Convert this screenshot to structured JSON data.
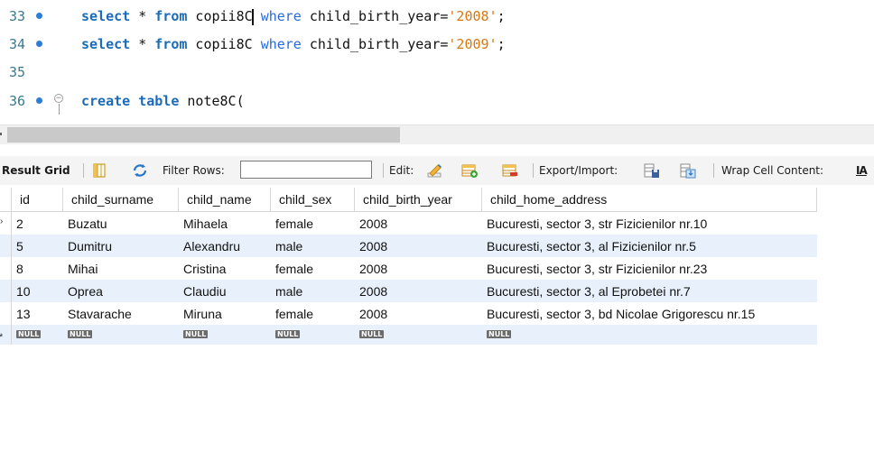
{
  "editor": {
    "lines": [
      {
        "num": "33",
        "parts": [
          [
            "kw",
            "select"
          ],
          [
            "",
            " * "
          ],
          [
            "kw",
            "from"
          ],
          [
            "",
            " copii8C"
          ],
          [
            "caret",
            ""
          ],
          [
            "",
            " "
          ],
          [
            "kw2",
            "where"
          ],
          [
            "",
            " child_birth_year="
          ],
          [
            "str",
            "'2008'"
          ],
          [
            "",
            ";"
          ]
        ]
      },
      {
        "num": "34",
        "parts": [
          [
            "kw",
            "select"
          ],
          [
            "",
            " * "
          ],
          [
            "kw",
            "from"
          ],
          [
            "",
            " copii8C "
          ],
          [
            "kw2",
            "where"
          ],
          [
            "",
            " child_birth_year="
          ],
          [
            "str",
            "'2009'"
          ],
          [
            "",
            ";"
          ]
        ]
      },
      {
        "num": "35",
        "parts": []
      },
      {
        "num": "36",
        "parts": [
          [
            "kw",
            "create"
          ],
          [
            "",
            " "
          ],
          [
            "kw",
            "table"
          ],
          [
            "",
            " note8C("
          ]
        ]
      }
    ]
  },
  "toolbar": {
    "result_grid_label": "Result Grid",
    "filter_rows_label": "Filter Rows:",
    "filter_value": "",
    "edit_label": "Edit:",
    "export_import_label": "Export/Import:",
    "wrap_cell_label": "Wrap Cell Content:",
    "wrap_icon_text": "IA"
  },
  "grid": {
    "columns": [
      "id",
      "child_surname",
      "child_name",
      "child_sex",
      "child_birth_year",
      "child_home_address"
    ],
    "rows": [
      [
        "2",
        "Buzatu",
        "Mihaela",
        "female",
        "2008",
        "Bucuresti, sector 3, str Fizicienilor nr.10"
      ],
      [
        "5",
        "Dumitru",
        "Alexandru",
        "male",
        "2008",
        "Bucuresti, sector 3, al Fizicienilor nr.5"
      ],
      [
        "8",
        "Mihai",
        "Cristina",
        "female",
        "2008",
        "Bucuresti, sector 3, str Fizicienilor nr.23"
      ],
      [
        "10",
        "Oprea",
        "Claudiu",
        "male",
        "2008",
        "Bucuresti, sector 3, al Eprobetei nr.7"
      ],
      [
        "13",
        "Stavarache",
        "Miruna",
        "female",
        "2008",
        "Bucuresti, sector 3, bd Nicolae Grigorescu nr.15"
      ]
    ],
    "null_label": "NULL",
    "current_row_marker": "›",
    "new_row_marker": "*"
  }
}
